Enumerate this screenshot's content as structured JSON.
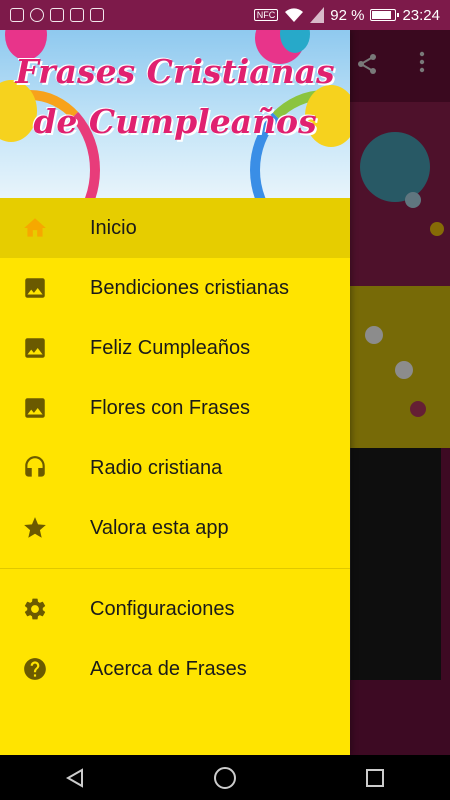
{
  "status_bar": {
    "nfc": "NFC",
    "battery_percent": "92 %",
    "battery_level": 0.92,
    "time": "23:24"
  },
  "drawer": {
    "header_title_line1": "Frases Cristianas",
    "header_title_line2": "de Cumpleaños",
    "items": [
      {
        "label": "Inicio",
        "icon": "home-icon",
        "active": true
      },
      {
        "label": "Bendiciones cristianas",
        "icon": "image-icon"
      },
      {
        "label": "Feliz Cumpleaños",
        "icon": "image-icon"
      },
      {
        "label": "Flores con Frases",
        "icon": "image-icon"
      },
      {
        "label": "Radio cristiana",
        "icon": "headphones-icon"
      },
      {
        "label": "Valora esta app",
        "icon": "star-icon"
      }
    ],
    "secondary_items": [
      {
        "label": "Configuraciones",
        "icon": "gear-icon"
      },
      {
        "label": "Acerca de Frases",
        "icon": "help-icon"
      }
    ]
  },
  "colors": {
    "drawer_bg": "#ffe400",
    "active_bg": "#e6cd00",
    "icon": "#6b5a00",
    "header_title": "#e02170",
    "toolbar": "#6b1239"
  }
}
